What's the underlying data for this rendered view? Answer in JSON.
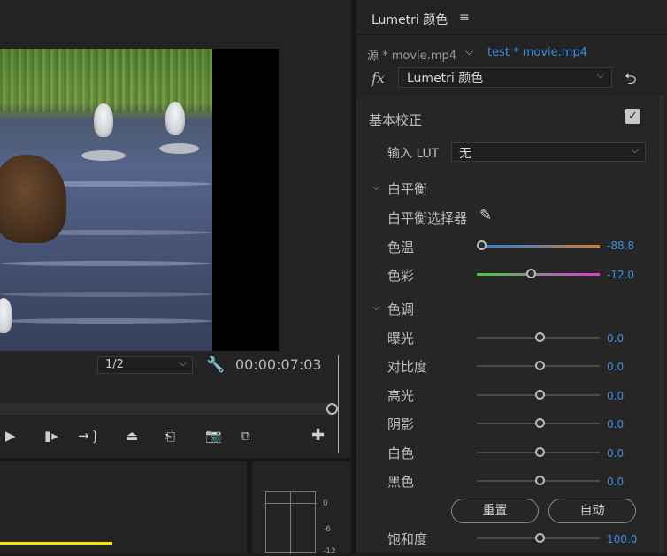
{
  "monitor": {
    "zoom_value": "1/2",
    "timecode": "00:00:07:03"
  },
  "meter": {
    "db_labels": [
      "0",
      "-6",
      "-12"
    ]
  },
  "panel": {
    "title": "Lumetri 颜色",
    "source_label": "源 * movie.mp4",
    "sequence_label": "test * movie.mp4",
    "effect_name": "Lumetri 颜色",
    "basic_correction": {
      "label": "基本校正",
      "enabled": true,
      "input_lut_label": "输入 LUT",
      "input_lut_value": "无",
      "white_balance": {
        "label": "白平衡",
        "selector_label": "白平衡选择器",
        "sliders": [
          {
            "label": "色温",
            "value": "-88.8"
          },
          {
            "label": "色彩",
            "value": "-12.0"
          }
        ]
      },
      "tone": {
        "label": "色调",
        "sliders": [
          {
            "label": "曝光",
            "value": "0.0"
          },
          {
            "label": "对比度",
            "value": "0.0"
          },
          {
            "label": "高光",
            "value": "0.0"
          },
          {
            "label": "阴影",
            "value": "0.0"
          },
          {
            "label": "白色",
            "value": "0.0"
          },
          {
            "label": "黑色",
            "value": "0.0"
          }
        ],
        "reset_label": "重置",
        "auto_label": "自动"
      },
      "saturation": {
        "label": "饱和度",
        "value": "100.0"
      }
    }
  },
  "colors": {
    "accent_blue": "#3d8fe0",
    "temp_cool": "#2f7fd8",
    "temp_warm": "#e07b22",
    "tint_green": "#3fcf3f",
    "tint_magenta": "#d43fd4",
    "timeline_yellow": "#f2e600"
  }
}
